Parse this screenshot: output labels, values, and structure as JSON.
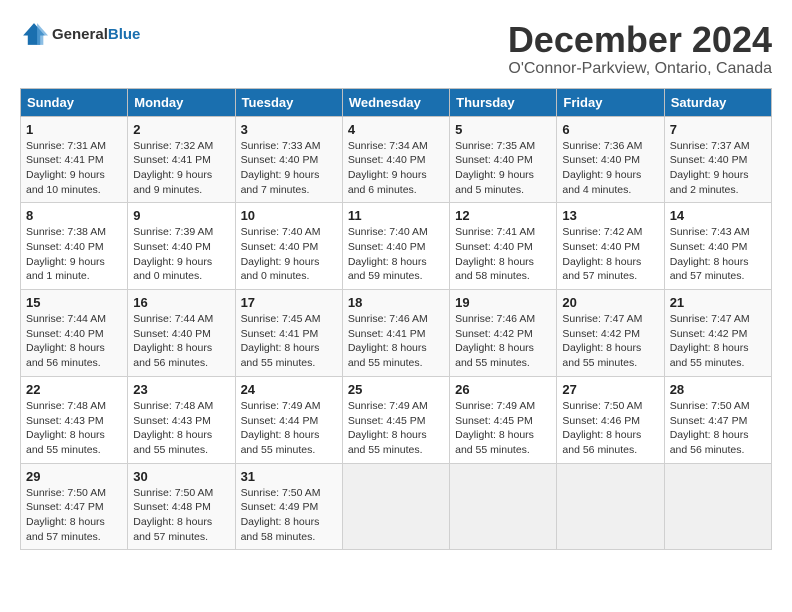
{
  "logo": {
    "text_general": "General",
    "text_blue": "Blue"
  },
  "title": "December 2024",
  "subtitle": "O'Connor-Parkview, Ontario, Canada",
  "calendar": {
    "headers": [
      "Sunday",
      "Monday",
      "Tuesday",
      "Wednesday",
      "Thursday",
      "Friday",
      "Saturday"
    ],
    "weeks": [
      [
        {
          "day": "1",
          "info": "Sunrise: 7:31 AM\nSunset: 4:41 PM\nDaylight: 9 hours and 10 minutes."
        },
        {
          "day": "2",
          "info": "Sunrise: 7:32 AM\nSunset: 4:41 PM\nDaylight: 9 hours and 9 minutes."
        },
        {
          "day": "3",
          "info": "Sunrise: 7:33 AM\nSunset: 4:40 PM\nDaylight: 9 hours and 7 minutes."
        },
        {
          "day": "4",
          "info": "Sunrise: 7:34 AM\nSunset: 4:40 PM\nDaylight: 9 hours and 6 minutes."
        },
        {
          "day": "5",
          "info": "Sunrise: 7:35 AM\nSunset: 4:40 PM\nDaylight: 9 hours and 5 minutes."
        },
        {
          "day": "6",
          "info": "Sunrise: 7:36 AM\nSunset: 4:40 PM\nDaylight: 9 hours and 4 minutes."
        },
        {
          "day": "7",
          "info": "Sunrise: 7:37 AM\nSunset: 4:40 PM\nDaylight: 9 hours and 2 minutes."
        }
      ],
      [
        {
          "day": "8",
          "info": "Sunrise: 7:38 AM\nSunset: 4:40 PM\nDaylight: 9 hours and 1 minute."
        },
        {
          "day": "9",
          "info": "Sunrise: 7:39 AM\nSunset: 4:40 PM\nDaylight: 9 hours and 0 minutes."
        },
        {
          "day": "10",
          "info": "Sunrise: 7:40 AM\nSunset: 4:40 PM\nDaylight: 9 hours and 0 minutes."
        },
        {
          "day": "11",
          "info": "Sunrise: 7:40 AM\nSunset: 4:40 PM\nDaylight: 8 hours and 59 minutes."
        },
        {
          "day": "12",
          "info": "Sunrise: 7:41 AM\nSunset: 4:40 PM\nDaylight: 8 hours and 58 minutes."
        },
        {
          "day": "13",
          "info": "Sunrise: 7:42 AM\nSunset: 4:40 PM\nDaylight: 8 hours and 57 minutes."
        },
        {
          "day": "14",
          "info": "Sunrise: 7:43 AM\nSunset: 4:40 PM\nDaylight: 8 hours and 57 minutes."
        }
      ],
      [
        {
          "day": "15",
          "info": "Sunrise: 7:44 AM\nSunset: 4:40 PM\nDaylight: 8 hours and 56 minutes."
        },
        {
          "day": "16",
          "info": "Sunrise: 7:44 AM\nSunset: 4:40 PM\nDaylight: 8 hours and 56 minutes."
        },
        {
          "day": "17",
          "info": "Sunrise: 7:45 AM\nSunset: 4:41 PM\nDaylight: 8 hours and 55 minutes."
        },
        {
          "day": "18",
          "info": "Sunrise: 7:46 AM\nSunset: 4:41 PM\nDaylight: 8 hours and 55 minutes."
        },
        {
          "day": "19",
          "info": "Sunrise: 7:46 AM\nSunset: 4:42 PM\nDaylight: 8 hours and 55 minutes."
        },
        {
          "day": "20",
          "info": "Sunrise: 7:47 AM\nSunset: 4:42 PM\nDaylight: 8 hours and 55 minutes."
        },
        {
          "day": "21",
          "info": "Sunrise: 7:47 AM\nSunset: 4:42 PM\nDaylight: 8 hours and 55 minutes."
        }
      ],
      [
        {
          "day": "22",
          "info": "Sunrise: 7:48 AM\nSunset: 4:43 PM\nDaylight: 8 hours and 55 minutes."
        },
        {
          "day": "23",
          "info": "Sunrise: 7:48 AM\nSunset: 4:43 PM\nDaylight: 8 hours and 55 minutes."
        },
        {
          "day": "24",
          "info": "Sunrise: 7:49 AM\nSunset: 4:44 PM\nDaylight: 8 hours and 55 minutes."
        },
        {
          "day": "25",
          "info": "Sunrise: 7:49 AM\nSunset: 4:45 PM\nDaylight: 8 hours and 55 minutes."
        },
        {
          "day": "26",
          "info": "Sunrise: 7:49 AM\nSunset: 4:45 PM\nDaylight: 8 hours and 55 minutes."
        },
        {
          "day": "27",
          "info": "Sunrise: 7:50 AM\nSunset: 4:46 PM\nDaylight: 8 hours and 56 minutes."
        },
        {
          "day": "28",
          "info": "Sunrise: 7:50 AM\nSunset: 4:47 PM\nDaylight: 8 hours and 56 minutes."
        }
      ],
      [
        {
          "day": "29",
          "info": "Sunrise: 7:50 AM\nSunset: 4:47 PM\nDaylight: 8 hours and 57 minutes."
        },
        {
          "day": "30",
          "info": "Sunrise: 7:50 AM\nSunset: 4:48 PM\nDaylight: 8 hours and 57 minutes."
        },
        {
          "day": "31",
          "info": "Sunrise: 7:50 AM\nSunset: 4:49 PM\nDaylight: 8 hours and 58 minutes."
        },
        {
          "day": "",
          "info": ""
        },
        {
          "day": "",
          "info": ""
        },
        {
          "day": "",
          "info": ""
        },
        {
          "day": "",
          "info": ""
        }
      ]
    ]
  }
}
